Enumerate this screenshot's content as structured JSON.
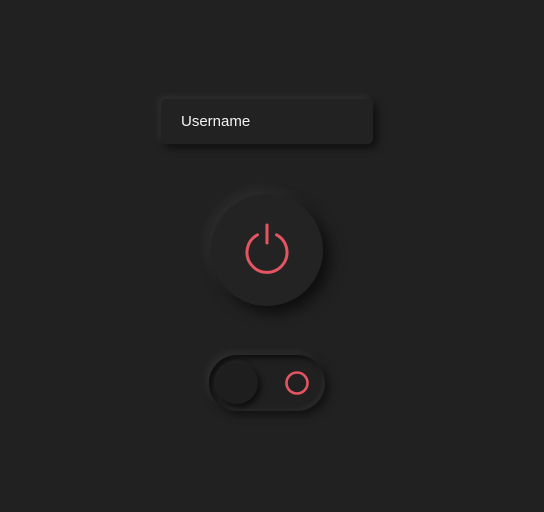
{
  "username_field": {
    "placeholder": "Username",
    "value": ""
  },
  "power_button": {
    "icon": "power-icon",
    "icon_color": "#e35561"
  },
  "toggle_switch": {
    "state": "off",
    "indicator_icon": "ring-icon",
    "indicator_color": "#e35561"
  },
  "colors": {
    "background": "#212121",
    "accent": "#e35561",
    "text": "#ffffff"
  }
}
